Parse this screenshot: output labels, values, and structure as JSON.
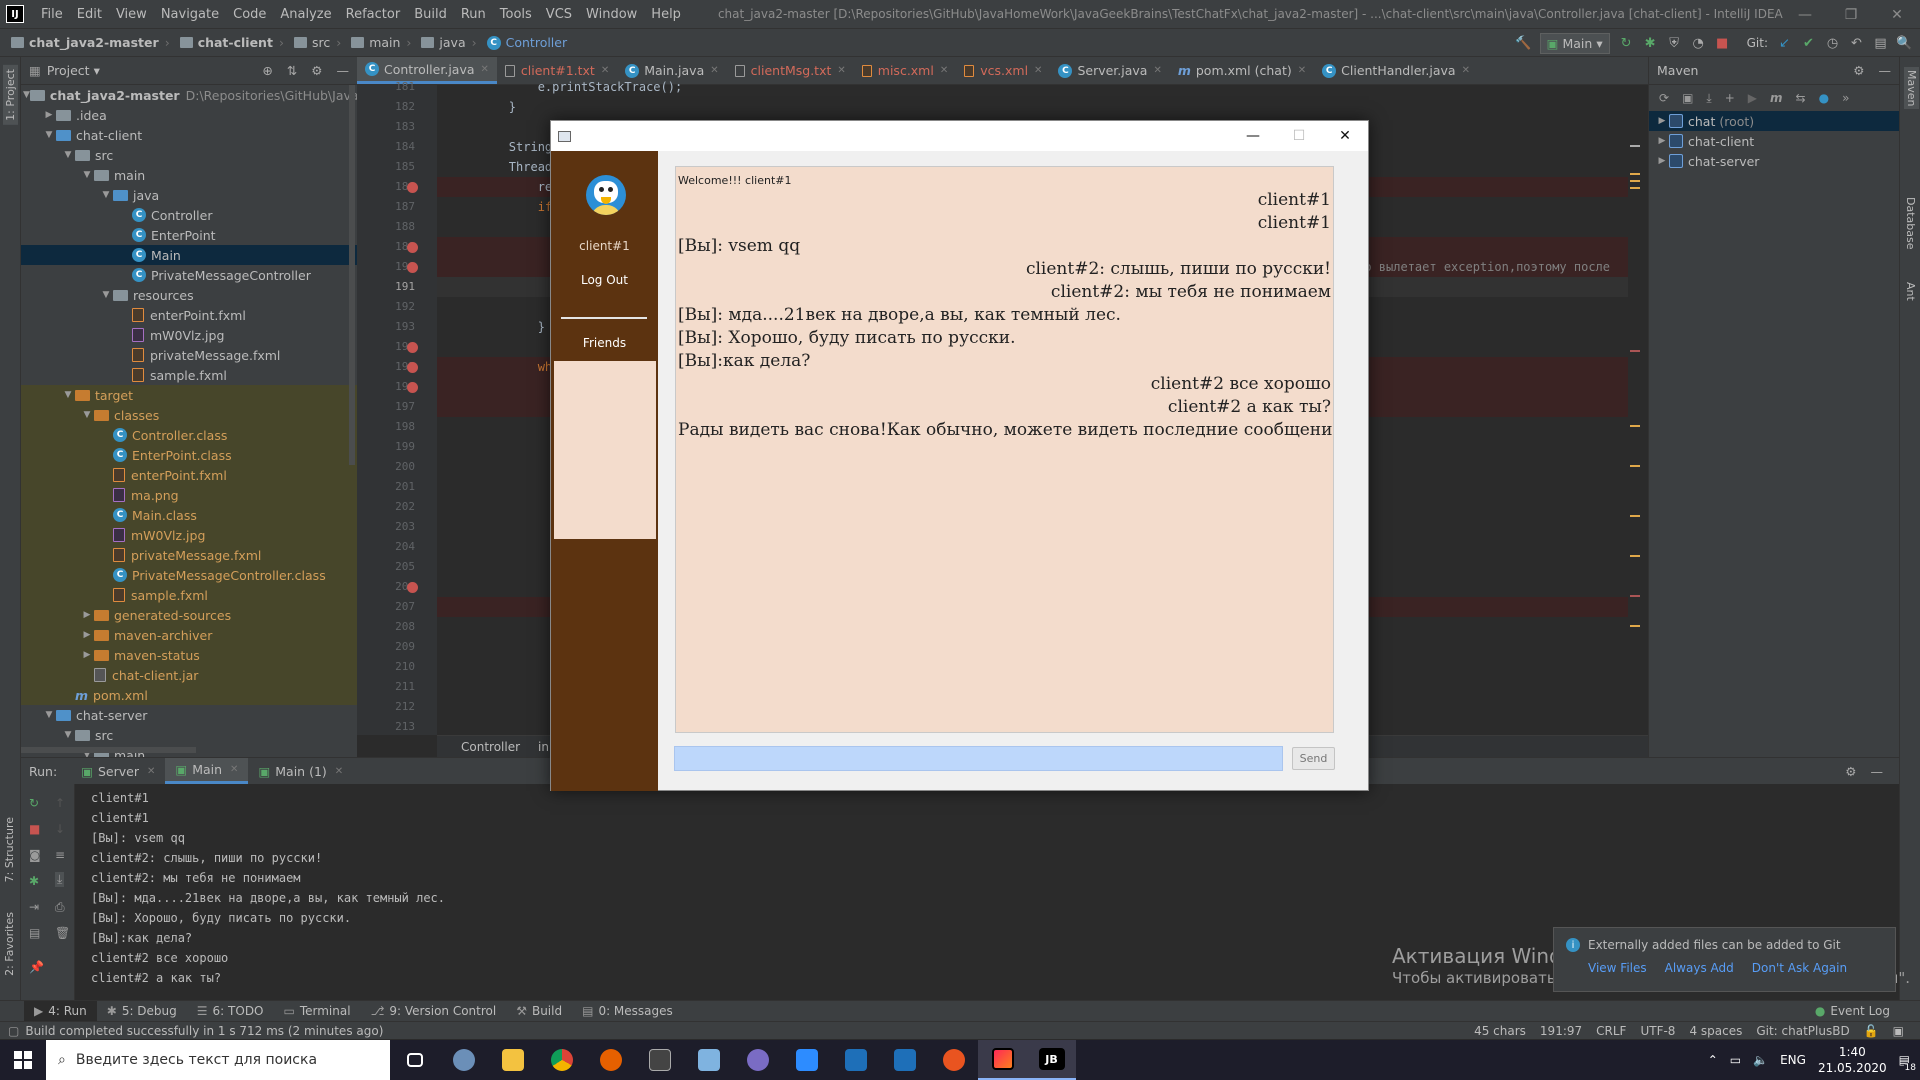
{
  "ide": {
    "menu": [
      "File",
      "Edit",
      "View",
      "Navigate",
      "Code",
      "Analyze",
      "Refactor",
      "Build",
      "Run",
      "Tools",
      "VCS",
      "Window",
      "Help"
    ],
    "window_title": "chat_java2-master [D:\\Repositories\\GitHub\\JavaHomeWork\\JavaGeekBrains\\TestChatFx\\chat_java2-master] - ...\\chat-client\\src\\main\\java\\Controller.java [chat-client] - IntelliJ IDEA",
    "breadcrumbs": [
      "chat_java2-master",
      "chat-client",
      "src",
      "main",
      "java",
      "Controller"
    ],
    "run_config": "Main",
    "git_label": "Git:",
    "left_tabs": [
      "1: Project",
      "7: Structure",
      "2: Favorites"
    ],
    "right_tabs": [
      "Maven",
      "Database",
      "Ant"
    ],
    "project": {
      "title": "Project",
      "root_label": "chat_java2-master",
      "root_path": "D:\\Repositories\\GitHub\\JavaHomeW",
      "items": [
        ".idea",
        "chat-client",
        "src",
        "main",
        "java",
        "Controller",
        "EnterPoint",
        "Main",
        "PrivateMessageController",
        "resources",
        "enterPoint.fxml",
        "mW0Vlz.jpg",
        "privateMessage.fxml",
        "sample.fxml",
        "target",
        "classes",
        "Controller.class",
        "EnterPoint.class",
        "enterPoint.fxml",
        "ma.png",
        "Main.class",
        "mW0Vlz.jpg",
        "privateMessage.fxml",
        "PrivateMessageController.class",
        "sample.fxml",
        "generated-sources",
        "maven-archiver",
        "maven-status",
        "chat-client.jar",
        "pom.xml",
        "chat-server",
        "src",
        "main"
      ]
    },
    "editor_tabs": [
      {
        "label": "Controller.java",
        "state": "active"
      },
      {
        "label": "client#1.txt",
        "state": "err"
      },
      {
        "label": "Main.java",
        "state": ""
      },
      {
        "label": "clientMsg.txt",
        "state": "err"
      },
      {
        "label": "misc.xml",
        "state": "err"
      },
      {
        "label": "vcs.xml",
        "state": "err"
      },
      {
        "label": "Server.java",
        "state": ""
      },
      {
        "label": "pom.xml (chat)",
        "state": ""
      },
      {
        "label": "ClientHandler.java",
        "state": ""
      }
    ],
    "line_numbers": [
      "181",
      "182",
      "183",
      "184",
      "185",
      "186",
      "187",
      "188",
      "189",
      "190",
      "191",
      "192",
      "193",
      "194",
      "195",
      "196",
      "197",
      "198",
      "199",
      "200",
      "201",
      "202",
      "203",
      "204",
      "205",
      "206",
      "207",
      "208",
      "209",
      "210",
      "211",
      "212",
      "213"
    ],
    "code": {
      "l181": "e.printStackTrace();",
      "l182": "}",
      "l184": "String f",
      "l185": "Thread r",
      "l186": "read",
      "l187": "if (",
      "l190_comment": "о вылетает exception,поэтому после",
      "l192": "}",
      "l194": "whil"
    },
    "editor_breadcrumb": [
      "Controller",
      "initial"
    ],
    "maven": {
      "title": "Maven",
      "items": [
        {
          "label": "chat",
          "suffix": "(root)"
        },
        {
          "label": "chat-client",
          "suffix": ""
        },
        {
          "label": "chat-server",
          "suffix": ""
        }
      ]
    },
    "run": {
      "label": "Run:",
      "tabs": [
        "Server",
        "Main",
        "Main (1)"
      ],
      "console": [
        "client#1",
        "client#1",
        "[Вы]: vsem qq",
        "client#2: слышь, пиши по русски!",
        "client#2: мы тебя не понимаем",
        "[Вы]: мда....21век на дворе,а вы, как темный лес.",
        "[Вы]: Хорошо, буду писать по русски.",
        "[Вы]:как дела?",
        "client#2 все хорошо",
        "client#2 а как ты?"
      ]
    },
    "bottom_tabs": [
      "4: Run",
      "5: Debug",
      "6: TODO",
      "Terminal",
      "9: Version Control",
      "Build",
      "0: Messages"
    ],
    "event_log": "Event Log",
    "status": {
      "message": "Build completed successfully in 1 s 712 ms (2 minutes ago)",
      "chars": "45 chars",
      "pos": "191:97",
      "eol": "CRLF",
      "enc": "UTF-8",
      "indent": "4 spaces",
      "git": "Git: chatPlusBD"
    },
    "notification": {
      "message": "Externally added files can be added to Git",
      "links": [
        "View Files",
        "Always Add",
        "Don't Ask Again"
      ]
    }
  },
  "watermark": {
    "line1": "Активация Windows",
    "line2": "Чтобы активировать Windows, перейдите в раздел \"Параметры\"."
  },
  "chat_app": {
    "username": "client#1",
    "logout": "Log Out",
    "friends": "Friends",
    "send": "Send",
    "messages": [
      {
        "text": "Welcome!!! client#1",
        "align": "left",
        "small": true
      },
      {
        "text": "client#1",
        "align": "right"
      },
      {
        "text": "client#1",
        "align": "right"
      },
      {
        "text": "[Вы]: vsem qq",
        "align": "left"
      },
      {
        "text": "client#2: слышь, пиши по русски!",
        "align": "right"
      },
      {
        "text": "client#2: мы тебя не понимаем",
        "align": "right"
      },
      {
        "text": "[Вы]: мда....21век на дворе,а вы, как темный лес.",
        "align": "left"
      },
      {
        "text": "[Вы]: Хорошо, буду писать по русски.",
        "align": "left"
      },
      {
        "text": "[Вы]:как дела?",
        "align": "left"
      },
      {
        "text": "client#2 все хорошо",
        "align": "right"
      },
      {
        "text": "client#2 а как ты?",
        "align": "right"
      },
      {
        "text": "Рады видеть вас снова!Как обычно, можете видеть последние сообщения",
        "align": "right"
      }
    ]
  },
  "taskbar": {
    "search_placeholder": "Введите здесь текст для поиска",
    "lang": "ENG",
    "time": "1:40",
    "date": "21.05.2020",
    "notif_count": "18"
  }
}
